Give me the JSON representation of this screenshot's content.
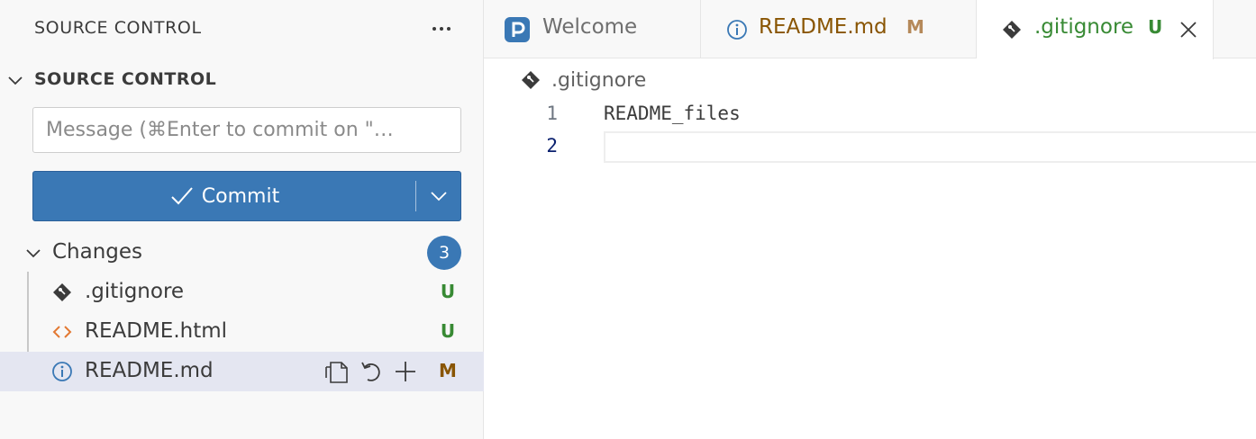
{
  "sidebar": {
    "title": "SOURCE CONTROL",
    "more_icon": "ellipsis-icon",
    "section_label": "SOURCE CONTROL",
    "message_placeholder": "Message (⌘Enter to commit on \"…",
    "commit_label": "Commit",
    "changes_label": "Changes",
    "changes_count": "3",
    "files": [
      {
        "name": ".gitignore",
        "status": "U",
        "icon": "git-file-icon"
      },
      {
        "name": "README.html",
        "status": "U",
        "icon": "html-file-icon"
      },
      {
        "name": "README.md",
        "status": "M",
        "icon": "info-file-icon",
        "selected": true,
        "actions": [
          "open-file-icon",
          "discard-changes-icon",
          "stage-changes-icon"
        ]
      }
    ]
  },
  "tabs": [
    {
      "label": "Welcome",
      "icon": "welcome-logo-icon",
      "status": "",
      "active": false
    },
    {
      "label": "README.md",
      "icon": "info-file-icon",
      "status": "M",
      "active": false
    },
    {
      "label": ".gitignore",
      "icon": "git-file-icon",
      "status": "U",
      "active": true
    }
  ],
  "breadcrumb": {
    "label": ".gitignore",
    "icon": "git-file-icon"
  },
  "editor": {
    "lines": [
      {
        "number": "1",
        "text": "README_files"
      },
      {
        "number": "2",
        "text": ""
      }
    ],
    "current_line": 2
  },
  "colors": {
    "accent": "#3a78b5",
    "untracked": "#388a34",
    "modified": "#895503",
    "html_icon": "#e37933",
    "info_icon": "#3a78b5",
    "selected_row": "#e4e6f1"
  }
}
